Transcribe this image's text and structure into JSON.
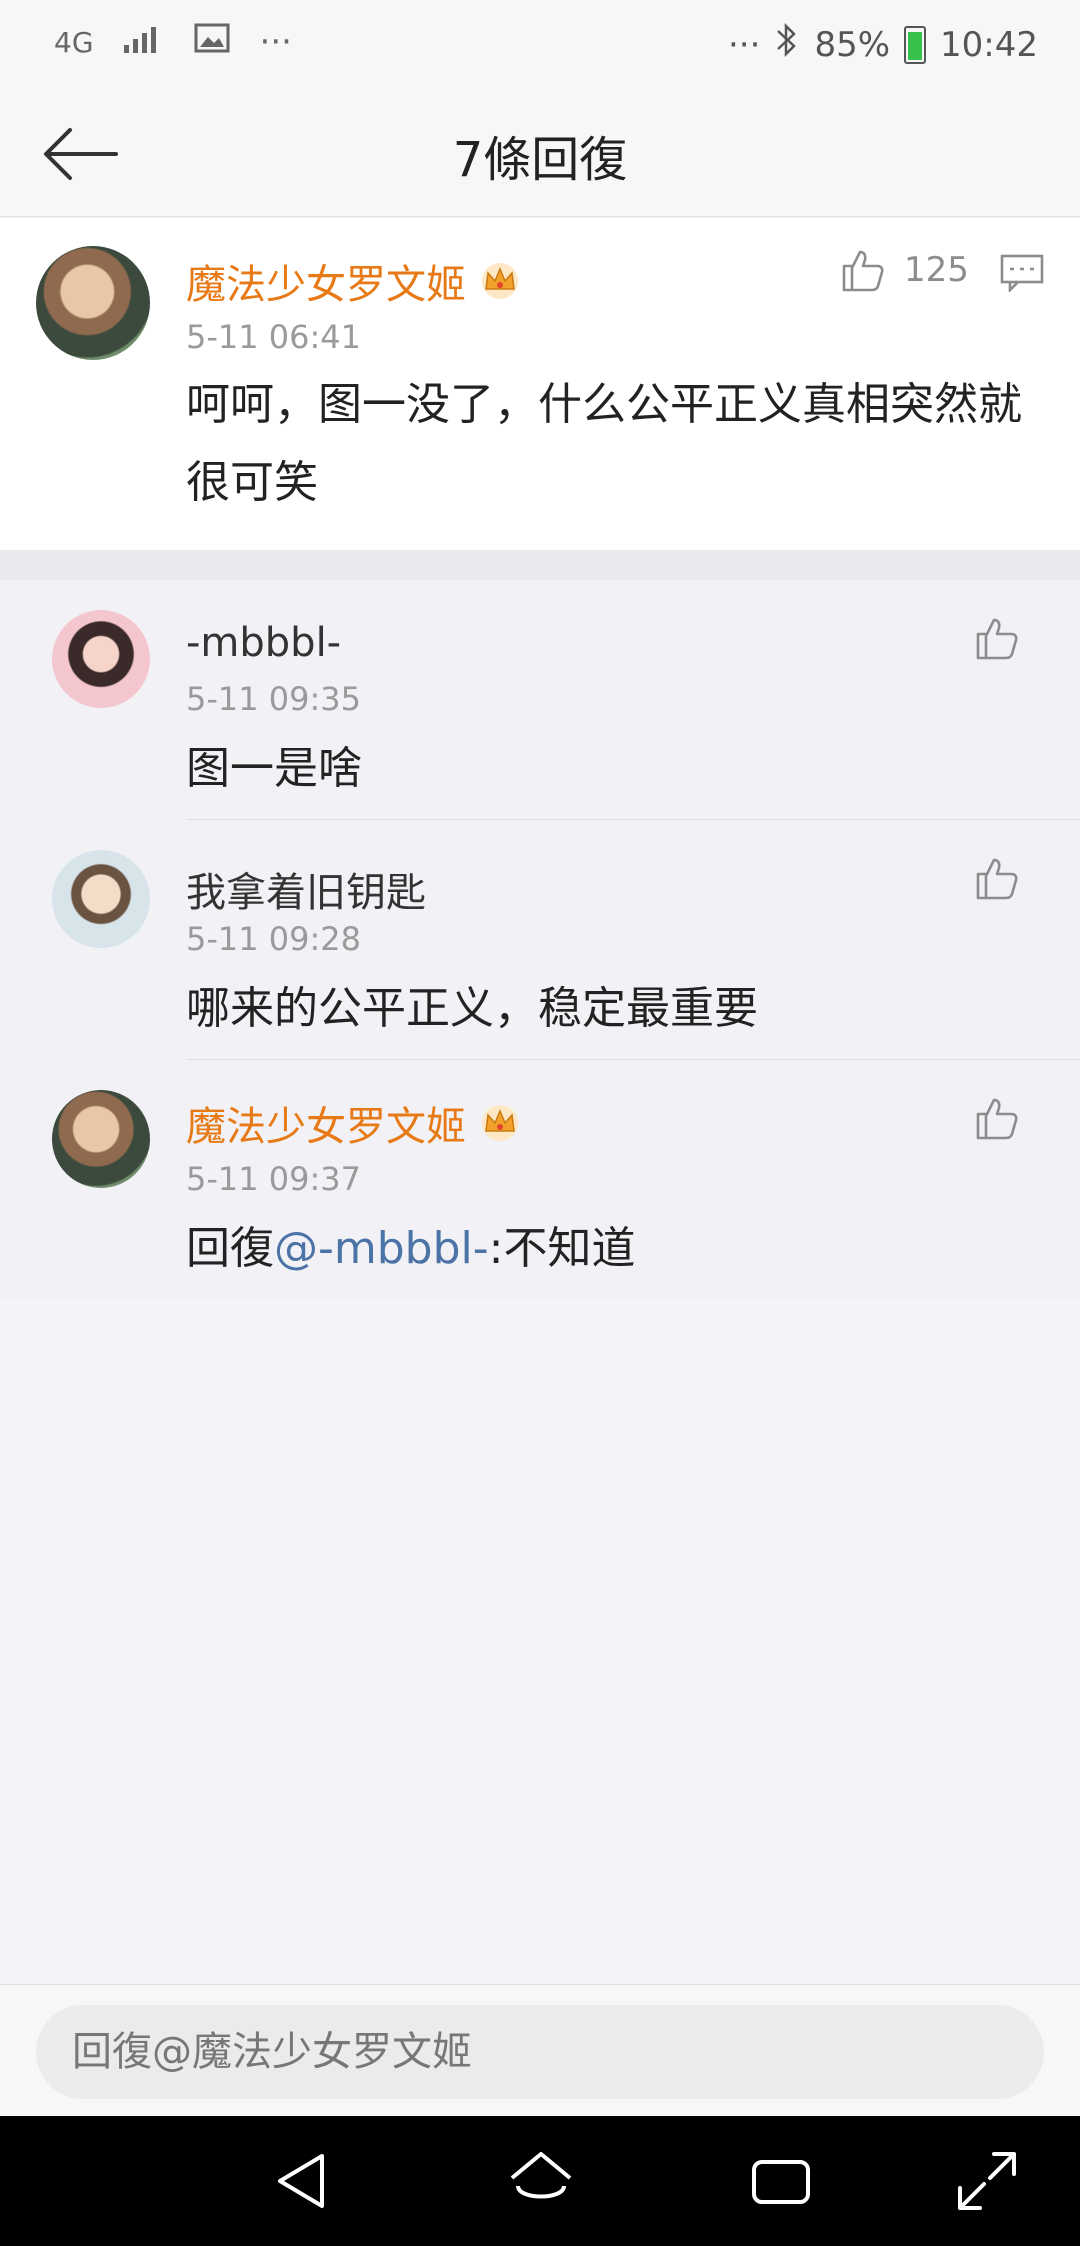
{
  "status_bar": {
    "network": "4G",
    "signal": "signal",
    "left_dots": "···",
    "right_dots": "···",
    "battery": "85%",
    "time": "10:42"
  },
  "header": {
    "title": "7條回復"
  },
  "main_comment": {
    "user": "魔法少女罗文姬",
    "time": "5-11 06:41",
    "text": "呵呵，图一没了，什么公平正义真相突然就很可笑",
    "like_count": "125"
  },
  "replies": [
    {
      "user": "-mbbbl-",
      "time": "5-11 09:35",
      "text": "图一是啥",
      "vip": false
    },
    {
      "user": "我拿着旧钥匙",
      "time": "5-11 09:28",
      "text": "哪来的公平正义，稳定最重要",
      "vip": false
    },
    {
      "user": "魔法少女罗文姬",
      "time": "5-11 09:37",
      "prefix": "回復",
      "mention": "@-mbbbl-",
      "suffix": ":不知道",
      "vip": true
    }
  ],
  "input": {
    "placeholder": "回復@魔法少女罗文姬"
  },
  "colors": {
    "vip_name": "#e77a16",
    "mention": "#4b73a6",
    "accent_crown": "#f2a22b"
  }
}
